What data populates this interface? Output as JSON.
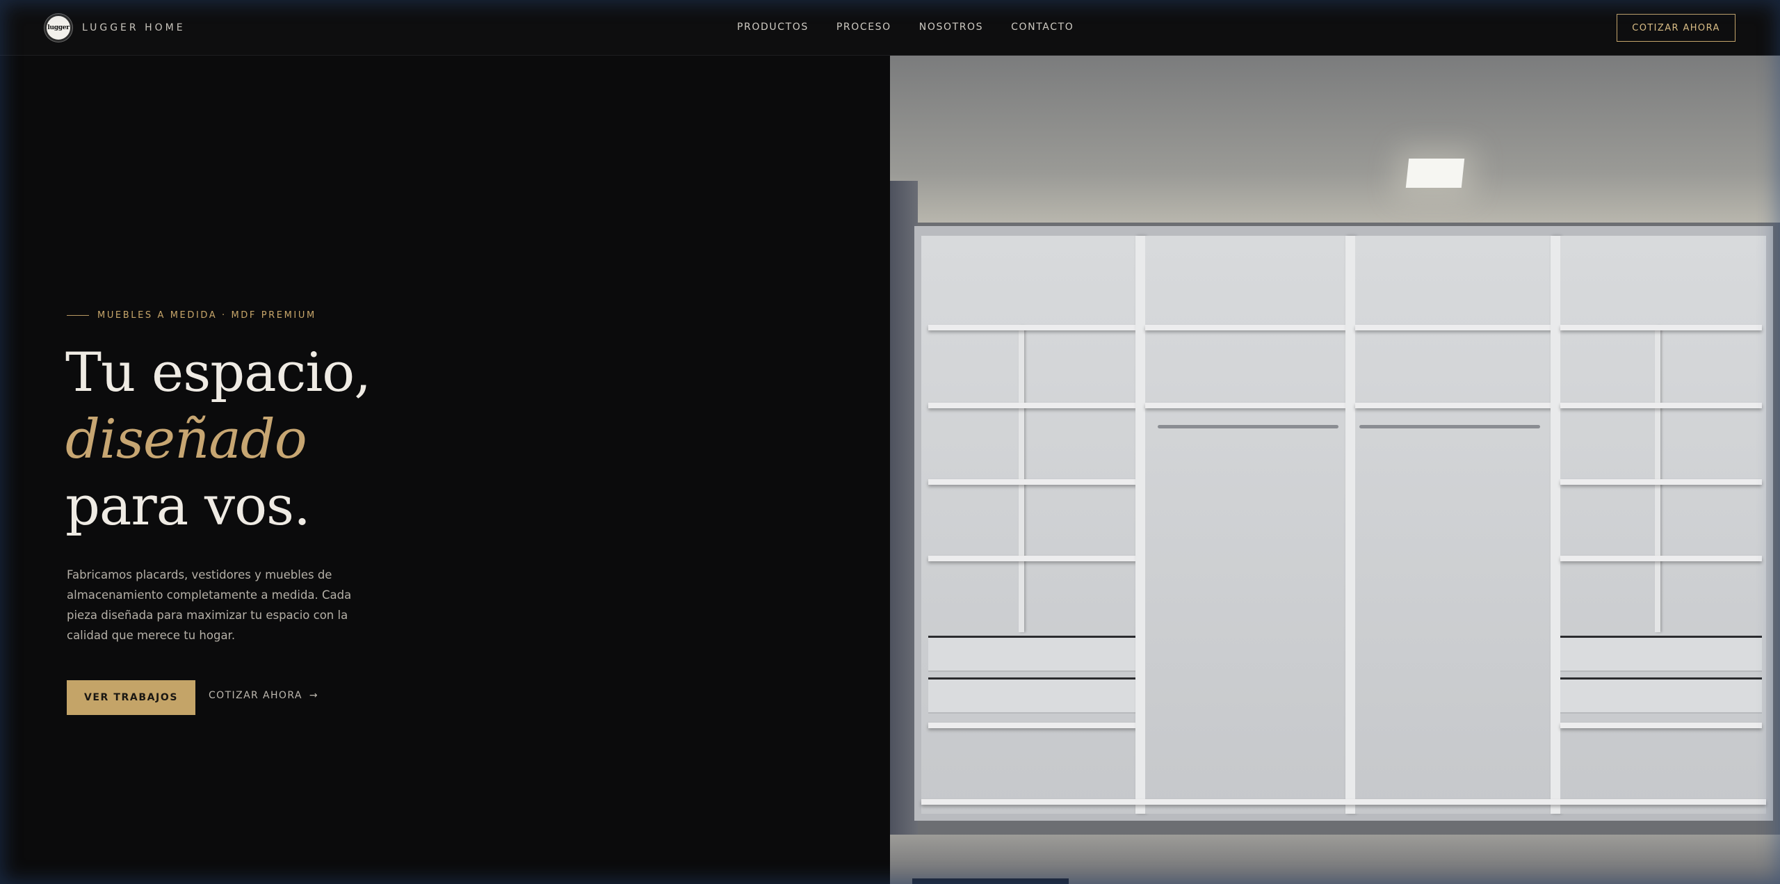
{
  "header": {
    "brand_logo_text": "lugger",
    "brand_name": "LUGGER HOME",
    "nav": [
      "PRODUCTOS",
      "PROCESO",
      "NOSOTROS",
      "CONTACTO"
    ],
    "cta_label": "COTIZAR AHORA"
  },
  "hero": {
    "eyebrow": "MUEBLES A MEDIDA · MDF PREMIUM",
    "headline_line1": "Tu espacio,",
    "headline_accent": "diseñado",
    "headline_line3": "para vos.",
    "lede": "Fabricamos placards, vestidores y muebles de almacenamiento completamente a medida. Cada pieza diseñada para maximizar tu espacio con la calidad que merece tu hogar.",
    "primary_button": "VER TRABAJOS",
    "secondary_link": "COTIZAR AHORA",
    "secondary_arrow": "→"
  },
  "colors": {
    "background": "#0b0b0c",
    "accent_gold": "#c4a468",
    "text_light": "#efebe4"
  },
  "icons": {
    "arrow": "arrow-right-icon"
  }
}
